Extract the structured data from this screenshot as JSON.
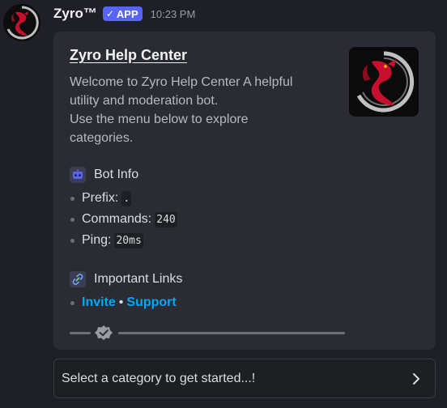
{
  "message": {
    "username": "Zyro™",
    "badge": "APP",
    "timestamp": "10:23 PM",
    "avatar_icon": "red-dragon-logo"
  },
  "embed": {
    "title": "Zyro Help Center",
    "description_lines": [
      "Welcome to Zyro Help Center A helpful",
      "utility and moderation bot.",
      "Use the menu below to explore",
      "categories."
    ],
    "thumbnail_icon": "red-dragon-logo",
    "bot_info": {
      "heading": "Bot Info",
      "icon": "robot-icon",
      "prefix_label": "Prefix:",
      "prefix_value": ".",
      "commands_label": "Commands:",
      "commands_value": "240",
      "ping_label": "Ping:",
      "ping_value": "20ms"
    },
    "links": {
      "heading": "Important Links",
      "icon": "link-icon",
      "invite": "Invite",
      "separator": "•",
      "support": "Support"
    },
    "footer_icon": "verified-badge-icon"
  },
  "select_menu": {
    "placeholder": "Select a category to get started...!",
    "chevron_icon": "chevron-right-icon"
  },
  "colors": {
    "background": "#1f1f27",
    "embed_bg": "#2b2c33",
    "badge": "#5865f2",
    "link": "#00a8fc",
    "dragon_red": "#c8102e"
  }
}
